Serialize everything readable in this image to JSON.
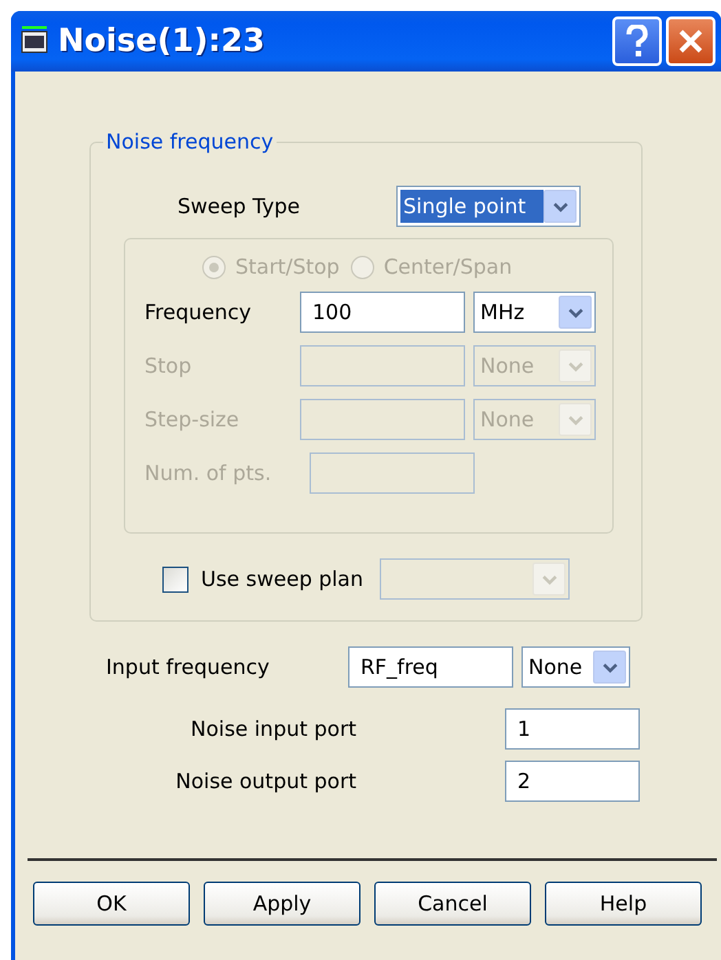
{
  "window": {
    "title": "Noise(1):23"
  },
  "noise_frequency": {
    "title": "Noise frequency",
    "sweep_type": {
      "label": "Sweep Type",
      "value": "Single point",
      "focused": true
    },
    "range_mode": [
      {
        "label": "Start/Stop",
        "selected": true,
        "disabled": true
      },
      {
        "label": "Center/Span",
        "selected": false,
        "disabled": true
      }
    ],
    "fields": [
      {
        "label": "Frequency",
        "value": "100",
        "unit": "MHz",
        "disabled": false
      },
      {
        "label": "Stop",
        "unit": "None",
        "disabled": true
      },
      {
        "label": "Step-size",
        "unit": "None",
        "disabled": true
      },
      {
        "label": "Num. of pts.",
        "disabled": true
      }
    ],
    "use_sweep_plan": {
      "label": "Use sweep plan",
      "checked": false,
      "plan_disabled": true
    }
  },
  "input_frequency": {
    "label": "Input frequency",
    "value": "RF_freq",
    "unit": "None"
  },
  "ports": [
    {
      "label": "Noise input port",
      "value": "1"
    },
    {
      "label": "Noise output port",
      "value": "2"
    }
  ],
  "buttons": [
    "OK",
    "Apply",
    "Cancel",
    "Help"
  ]
}
